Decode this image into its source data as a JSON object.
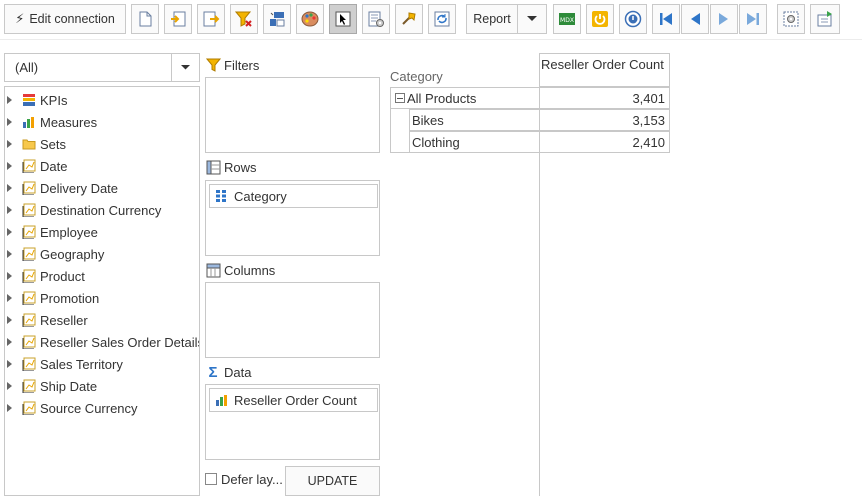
{
  "toolbar": {
    "edit_connection_label": "Edit connection",
    "report_label": "Report",
    "icons": [
      "new-page-icon",
      "import-icon",
      "export-icon",
      "clear-filter-icon",
      "pivot-swap-icon",
      "palette-icon",
      "select-cursor-icon",
      "settings-icon",
      "wizard-icon",
      "refresh-icon",
      "mdx-icon",
      "power-icon",
      "about-icon",
      "first-page-icon",
      "prev-page-icon",
      "next-page-icon",
      "last-page-icon",
      "options-icon",
      "save-export-icon"
    ]
  },
  "cube_selector": {
    "value": "(All)"
  },
  "tree_items": [
    {
      "label": "KPIs",
      "icon": "kpi-icon"
    },
    {
      "label": "Measures",
      "icon": "measures-icon"
    },
    {
      "label": "Sets",
      "icon": "folder-icon"
    },
    {
      "label": "Date",
      "icon": "dimension-icon"
    },
    {
      "label": "Delivery Date",
      "icon": "dimension-icon"
    },
    {
      "label": "Destination Currency",
      "icon": "dimension-icon"
    },
    {
      "label": "Employee",
      "icon": "dimension-icon"
    },
    {
      "label": "Geography",
      "icon": "dimension-icon"
    },
    {
      "label": "Product",
      "icon": "dimension-icon"
    },
    {
      "label": "Promotion",
      "icon": "dimension-icon"
    },
    {
      "label": "Reseller",
      "icon": "dimension-icon"
    },
    {
      "label": "Reseller Sales Order Details",
      "icon": "dimension-icon"
    },
    {
      "label": "Sales Territory",
      "icon": "dimension-icon"
    },
    {
      "label": "Ship Date",
      "icon": "dimension-icon"
    },
    {
      "label": "Source Currency",
      "icon": "dimension-icon"
    }
  ],
  "zones": {
    "filters_label": "Filters",
    "rows_label": "Rows",
    "columns_label": "Columns",
    "data_label": "Data",
    "rows_items": [
      "Category"
    ],
    "data_items": [
      "Reseller Order Count"
    ]
  },
  "defer_layout_label": "Defer lay...",
  "update_label": "UPDATE",
  "pivot": {
    "row_header_title": "Category",
    "measure_header": "Reseller Order Count",
    "rows": [
      {
        "label": "All Products",
        "value": "3,401"
      },
      {
        "label": "Bikes",
        "value": "3,153"
      },
      {
        "label": "Clothing",
        "value": "2,410"
      }
    ]
  },
  "colors": {
    "accent_blue": "#2e75c8",
    "gold": "#e8a500",
    "border": "#c8c8c8"
  }
}
